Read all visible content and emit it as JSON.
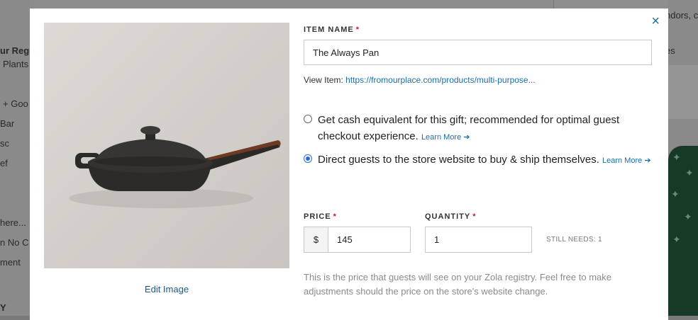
{
  "background": {
    "left_snippets": [
      "ur Regis",
      "Plants",
      "+ Goo",
      "Bar",
      "sc",
      "ef",
      "here...",
      "n No C",
      "ment",
      "Y"
    ],
    "right_snippets": [
      "ndors, c",
      "es"
    ]
  },
  "modal": {
    "close_label": "×",
    "edit_image_label": "Edit Image",
    "item_name": {
      "label": "ITEM NAME",
      "required_mark": "*",
      "value": "The Always Pan"
    },
    "view_item": {
      "label": "View Item:",
      "link_text": "https://fromourplace.com/products/multi-purpose..."
    },
    "options": [
      {
        "text": "Get cash equivalent for this gift; recommended for optimal guest checkout experience.",
        "learn_more": "Learn More ➔",
        "selected": false
      },
      {
        "text": "Direct guests to the store website to buy & ship themselves.",
        "learn_more": "Learn More ➔",
        "selected": true
      }
    ],
    "price": {
      "label": "PRICE",
      "required_mark": "*",
      "currency_symbol": "$",
      "value": "145"
    },
    "quantity": {
      "label": "QUANTITY",
      "required_mark": "*",
      "value": "1"
    },
    "still_needs": "STILL NEEDS: 1",
    "help_text": "This is the price that guests will see on your Zola registry. Feel free to make adjustments should the price on the store's website change."
  },
  "colors": {
    "link": "#1a6ea8",
    "required": "#c01a2b",
    "radio_selected": "#2a6cd6"
  }
}
